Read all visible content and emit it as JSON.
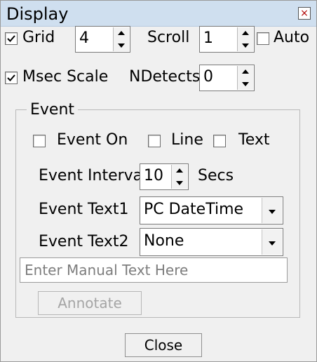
{
  "window": {
    "title": "Display",
    "close_glyph": "×"
  },
  "display": {
    "grid_checkbox": {
      "label": "Grid",
      "checked": true
    },
    "grid_value": "4",
    "scroll_label": "Scroll",
    "scroll_value": "1",
    "auto_checkbox": {
      "label": "Auto",
      "checked": false
    },
    "msec_scale_checkbox": {
      "label": "Msec Scale",
      "checked": true
    },
    "ndetects_label": "NDetects",
    "ndetects_value": "0"
  },
  "event": {
    "group_label": "Event",
    "event_on_checkbox": {
      "label": "Event On",
      "checked": false
    },
    "line_checkbox": {
      "label": "Line",
      "checked": false
    },
    "text_checkbox": {
      "label": "Text",
      "checked": false
    },
    "interval_label": "Event Interval",
    "interval_value": "10",
    "interval_unit": "Secs",
    "text1_label": "Event Text1",
    "text1_value": "PC DateTime",
    "text2_label": "Event Text2",
    "text2_value": "None",
    "manual_text_placeholder": "Enter Manual Text Here",
    "annotate_label": "Annotate"
  },
  "footer": {
    "close_label": "Close"
  },
  "icons": {
    "window_close": "close-icon",
    "check": "checkmark-icon",
    "spin_up": "triangle-up-icon",
    "spin_down": "triangle-down-icon",
    "dropdown": "chevron-down-icon"
  },
  "colors": {
    "window_background": "#f0f0f0",
    "titlebar_background": "#cfdfef",
    "close_x_color": "#b00000",
    "disabled_text": "#a5a5a5"
  }
}
